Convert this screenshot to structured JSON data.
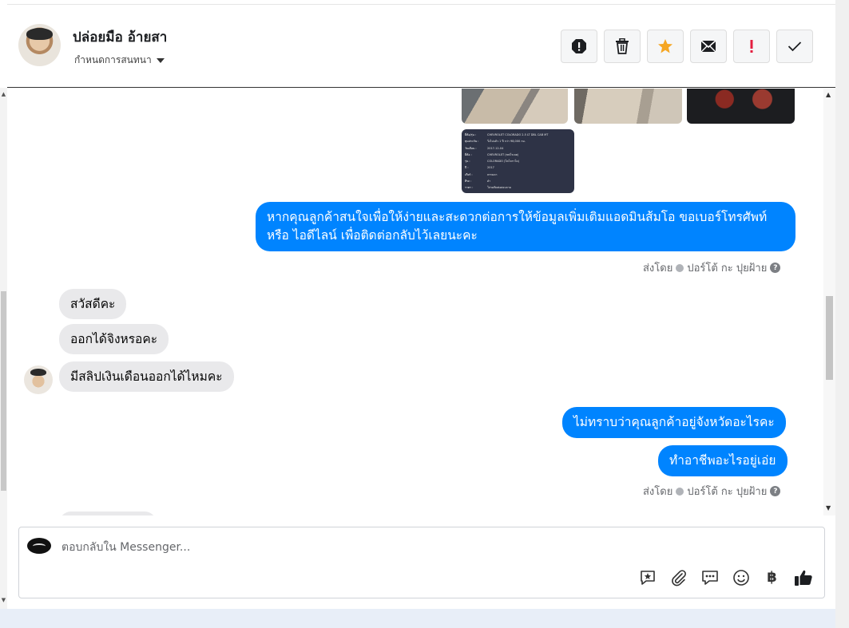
{
  "header": {
    "contact_name": "ปล่อยมือ อ้ายสา",
    "assign_label": "กำหนดการสนทนา",
    "actions": [
      {
        "icon": "block-icon"
      },
      {
        "icon": "trash-icon"
      },
      {
        "icon": "star-icon",
        "color": "#f5a623"
      },
      {
        "icon": "mail-icon"
      },
      {
        "icon": "important-icon",
        "color": "#e41e3f"
      },
      {
        "icon": "check-icon"
      }
    ]
  },
  "document_card": {
    "rows": [
      [
        "ยี่ห้อ/รุ่น :",
        "CHEVROLET COLORADO 2.5 LT DBL CAB MT"
      ],
      [
        "ทุนประกัน :",
        "วิ่งไปแล้ว 1 ปี กว่า 98,000 กม."
      ],
      [
        "วันเดือน :",
        "2017-12-04"
      ],
      [
        "ยี่ห้อ :",
        "CHEVROLET (ชฟโรเลต)"
      ],
      [
        "รุ่น :",
        "COLORADO (โคโลราโด)"
      ],
      [
        "ปี :",
        "2017"
      ],
      [
        "เกียร์ :",
        "ธรรมดา"
      ],
      [
        "สีรถ :",
        "ดำ"
      ],
      [
        "ราคา :",
        "โปรดติดต่อสอบถาม"
      ]
    ]
  },
  "messages": {
    "outgoing_1": "หากคุณลูกค้าสนใจเพื่อให้ง่ายและสะดวกต่อการให้ข้อมูลเพิ่มเติมแอดมินส้มโอ ขอเบอร์โทรศัพท์ หรือ ไอดีไลน์ เพื่อติดต่อกลับไว้เลยนะคะ",
    "sent_by_1": "ส่งโดย",
    "sender_1": "ปอร์โต้ กะ ปุยฝ้าย",
    "incoming": [
      "สวัสดีคะ",
      "ออกได้จิงหรอคะ",
      "มีสลิปเงินเดือนออกได้ไหมคะ"
    ],
    "outgoing_2": "ไม่ทราบว่าคุณลูกค้าอยู่จังหวัดอะไรคะ",
    "outgoing_3": "ทำอาชีพอะไรอยู่เอ่ย",
    "sent_by_2": "ส่งโดย",
    "sender_2": "ปอร์โต้ กะ ปุยฝ้าย"
  },
  "composer": {
    "placeholder": "ตอบกลับใน Messenger...",
    "tools": [
      "add-reaction-icon",
      "attachment-icon",
      "saved-reply-icon",
      "emoji-icon",
      "baht-icon",
      "like-icon"
    ],
    "baht_symbol": "฿"
  },
  "colors": {
    "outgoing_bubble": "#0084ff",
    "incoming_bubble": "#e9e9eb"
  }
}
